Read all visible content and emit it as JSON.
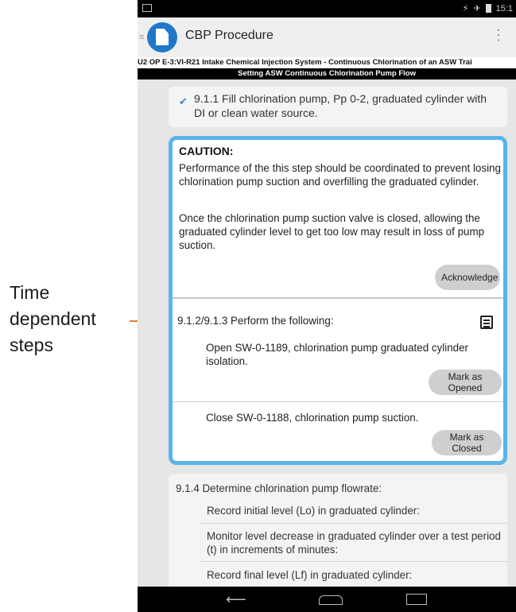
{
  "annotation": {
    "lines": [
      "Time",
      "dependent",
      "steps"
    ],
    "arrow_color": "#ed7d31"
  },
  "status_bar": {
    "time": "15:1"
  },
  "app_bar": {
    "title": "CBP Procedure"
  },
  "procedure": {
    "title": "U2 OP E-3:VI-R21 Intake Chemical Injection System - Continuous Chlorination of an ASW Trai",
    "section": "Setting ASW Continuous Chlorination Pump Flow"
  },
  "step_911": {
    "text": "9.1.1 Fill chlorination pump, Pp 0-2, graduated cylinder with DI or clean water source."
  },
  "caution": {
    "heading": "CAUTION:",
    "paragraph1": "Performance of the this step should be coordinated to prevent losing chlorination pump suction and overfilling the graduated cylinder.",
    "paragraph2": "Once the chlorination pump suction valve is closed, allowing the graduated cylinder level to get too low may result in loss of pump suction.",
    "acknowledge_label": "Acknowledge"
  },
  "step_912": {
    "heading": "9.1.2/9.1.3 Perform the following:",
    "sub1": "Open SW-0-1189, chlorination pump graduated cylinder isolation.",
    "sub1_button": "Mark as Opened",
    "sub2": "Close SW-0-1188, chlorination pump suction.",
    "sub2_button": "Mark as Closed"
  },
  "step_914": {
    "heading": "9.1.4 Determine chlorination pump flowrate:",
    "items": [
      "Record initial level (Lo) in graduated cylinder:",
      "Monitor level decrease in graduated cylinder over a test period (t) in increments of minutes:",
      "Record final level (Lf) in graduated cylinder:"
    ]
  },
  "colors": {
    "accent": "#5ab4ea",
    "logo": "#1f78c8"
  }
}
